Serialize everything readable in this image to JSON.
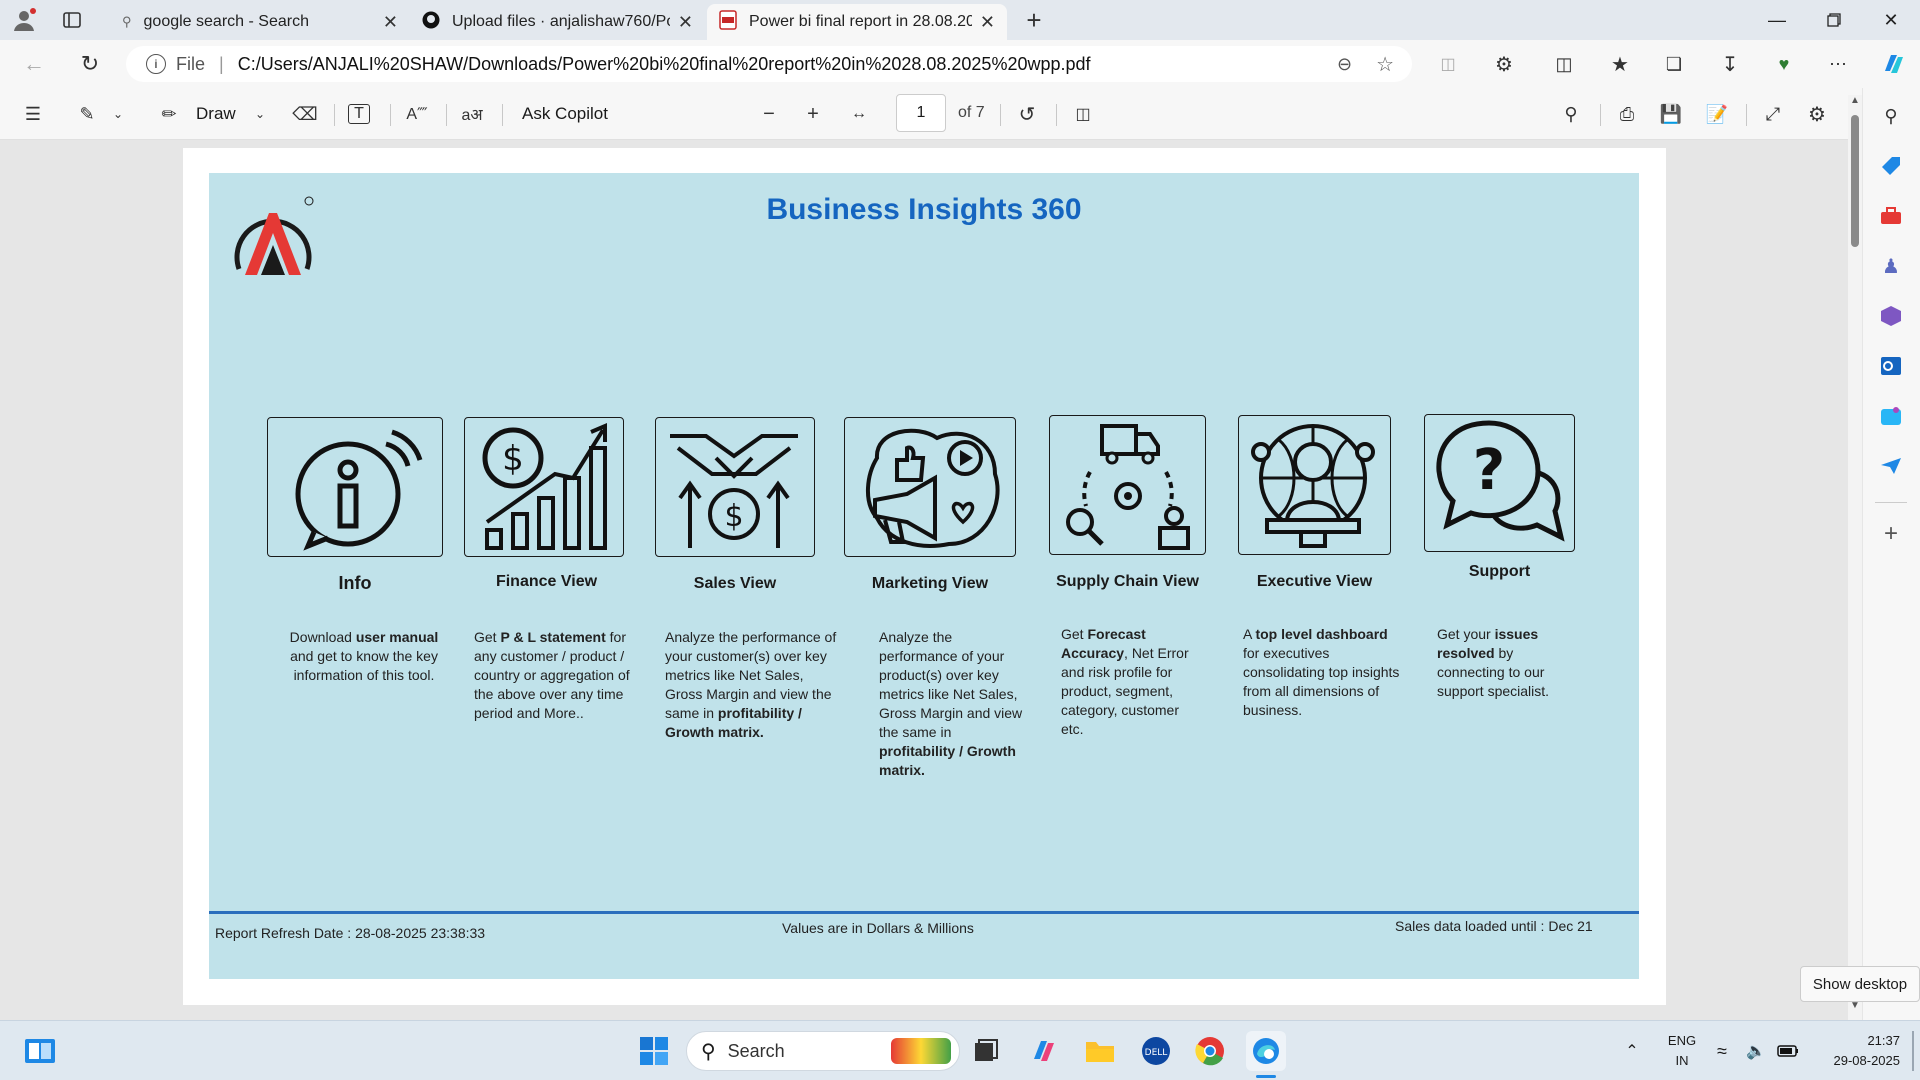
{
  "tabs": [
    {
      "title": "google search - Search",
      "icon": "search-icon"
    },
    {
      "title": "Upload files · anjalishaw760/Pow",
      "icon": "github-icon"
    },
    {
      "title": "Power bi final report in 28.08.202",
      "icon": "pdf-icon"
    }
  ],
  "address": {
    "file_label": "File",
    "url": "C:/Users/ANJALI%20SHAW/Downloads/Power%20bi%20final%20report%20in%2028.08.2025%20wpp.pdf"
  },
  "pdf_toolbar": {
    "draw_label": "Draw",
    "ask_copilot": "Ask Copilot",
    "page_number": "1",
    "page_total": "of 7"
  },
  "report": {
    "title": "Business Insights 360",
    "cards": [
      {
        "title": "Info",
        "desc": [
          "Download ",
          "user manual",
          " and get to know the key information of this tool."
        ]
      },
      {
        "title": "Finance View",
        "desc": [
          "Get ",
          " P & L statement",
          " for any customer / product / country or aggregation of the above over any time period and More.."
        ]
      },
      {
        "title": "Sales View",
        "desc": [
          "Analyze the performance of your customer(s) over key metrics like Net Sales, Gross Margin and view the same in ",
          "profitability / Growth matrix."
        ]
      },
      {
        "title": "Marketing View",
        "desc": [
          "Analyze the performance of your product(s) over key metrics like Net Sales, Gross Margin and view the same in ",
          "profitability / Growth matrix."
        ]
      },
      {
        "title": "Supply Chain View",
        "desc": [
          "Get ",
          "Forecast Accuracy",
          ", Net Error and risk profile for product, segment, category, customer etc."
        ]
      },
      {
        "title": "Executive View",
        "desc": [
          "A ",
          "top level dashboard",
          " for executives consolidating top insights from all dimensions of business."
        ]
      },
      {
        "title": "Support",
        "desc": [
          "Get your ",
          "issues resolved",
          " by connecting to our support specialist."
        ]
      }
    ],
    "refresh_label": "Report Refresh Date :",
    "refresh_value": "28-08-2025 23:38:33",
    "values_note": "Values are in Dollars & Millions",
    "loaded_note": "Sales data loaded until : Dec 21"
  },
  "tooltip": "Show desktop",
  "taskbar": {
    "search_placeholder": "Search",
    "lang": "ENG",
    "region": "IN",
    "time": "21:37",
    "date": "29-08-2025"
  },
  "colors": {
    "slide_bg": "#c0e2ea",
    "title": "#1565c0",
    "footer_line": "#2a6ebd"
  }
}
